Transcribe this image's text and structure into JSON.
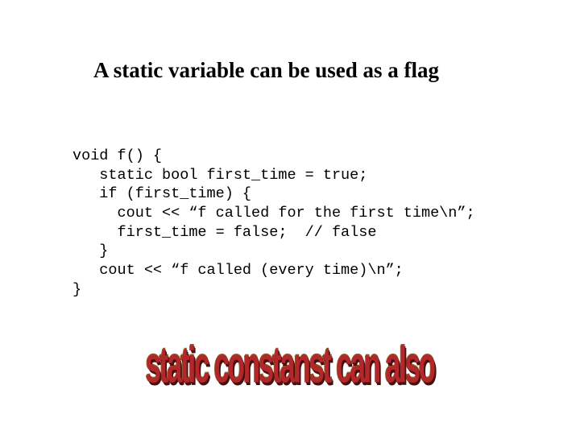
{
  "title": "A static variable can be used as a flag",
  "code": {
    "l1": "void f() {",
    "l2": "   static bool first_time = true;",
    "l3": "   if (first_time) {",
    "l4": "     cout << “f called for the first time\\n”;",
    "l5": "     first_time = false;  // false",
    "l6": "   }",
    "l7": "   cout << “f called (every time)\\n”;",
    "l8": "}"
  },
  "wordart": "static constanst can also"
}
